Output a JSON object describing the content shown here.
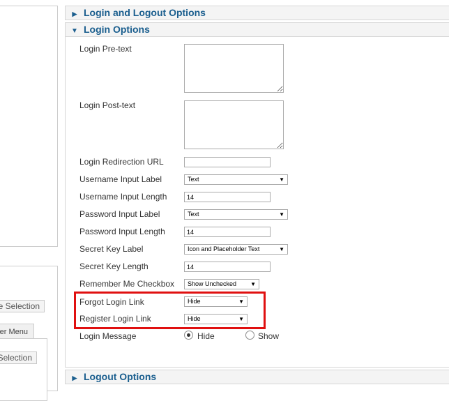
{
  "left": {
    "button_1": "e Selection",
    "tab_label": "er Menu",
    "button_2": "Selection"
  },
  "panels": {
    "login_logout": "Login and Logout Options",
    "login_options": "Login Options",
    "logout_options": "Logout Options"
  },
  "fields": {
    "pretext": {
      "label": "Login Pre-text",
      "value": ""
    },
    "posttext": {
      "label": "Login Post-text",
      "value": ""
    },
    "redirect_url": {
      "label": "Login Redirection URL",
      "value": ""
    },
    "username_label": {
      "label": "Username Input Label",
      "value": "Text"
    },
    "username_length": {
      "label": "Username Input Length",
      "value": "14"
    },
    "password_label": {
      "label": "Password Input Label",
      "value": "Text"
    },
    "password_length": {
      "label": "Password Input Length",
      "value": "14"
    },
    "secret_label": {
      "label": "Secret Key Label",
      "value": "Icon and Placeholder Text"
    },
    "secret_length": {
      "label": "Secret Key Length",
      "value": "14"
    },
    "remember_me": {
      "label": "Remember Me Checkbox",
      "value": "Show Unchecked"
    },
    "forgot_link": {
      "label": "Forgot Login Link",
      "value": "Hide"
    },
    "register_link": {
      "label": "Register Login Link",
      "value": "Hide"
    },
    "login_message": {
      "label": "Login Message",
      "options": [
        "Hide",
        "Show"
      ],
      "selected": "Hide"
    }
  },
  "colors": {
    "panel_title": "#1a5e8e",
    "highlight": "#e01010"
  },
  "icons": {
    "collapsed": "triangle-right-icon",
    "expanded": "triangle-down-icon",
    "dropdown": "triangle-down-icon"
  }
}
